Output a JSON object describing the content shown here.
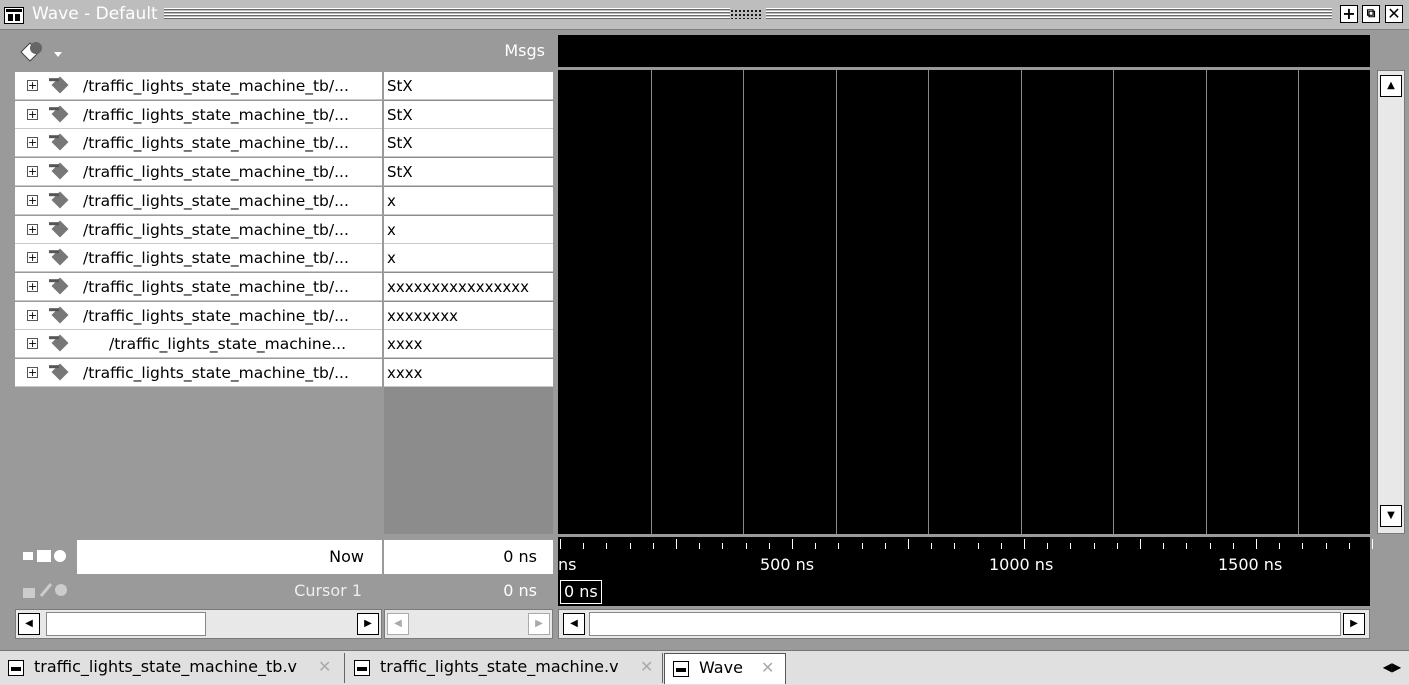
{
  "window": {
    "title": "Wave - Default"
  },
  "columns": {
    "msgs": "Msgs"
  },
  "signals": [
    {
      "name": "/traffic_lights_state_machine_tb/...",
      "value": "StX"
    },
    {
      "name": "/traffic_lights_state_machine_tb/...",
      "value": "StX"
    },
    {
      "name": "/traffic_lights_state_machine_tb/...",
      "value": "StX"
    },
    {
      "name": "/traffic_lights_state_machine_tb/...",
      "value": "StX"
    },
    {
      "name": "/traffic_lights_state_machine_tb/...",
      "value": "x"
    },
    {
      "name": "/traffic_lights_state_machine_tb/...",
      "value": "x"
    },
    {
      "name": "/traffic_lights_state_machine_tb/...",
      "value": "x"
    },
    {
      "name": "/traffic_lights_state_machine_tb/...",
      "value": "xxxxxxxxxxxxxxxx"
    },
    {
      "name": "/traffic_lights_state_machine_tb/...",
      "value": "xxxxxxxx"
    },
    {
      "name": "/traffic_lights_state_machine...",
      "value": "xxxx"
    },
    {
      "name": "/traffic_lights_state_machine_tb/...",
      "value": "xxxx"
    }
  ],
  "now": {
    "label": "Now",
    "value": "0 ns"
  },
  "cursor": {
    "label": "Cursor 1",
    "value": "0 ns",
    "marker": "0 ns"
  },
  "timeline": {
    "start_label": "ns",
    "labels": [
      "500 ns",
      "1000 ns",
      "1500 ns"
    ]
  },
  "tabs": [
    {
      "label": "traffic_lights_state_machine_tb.v"
    },
    {
      "label": "traffic_lights_state_machine.v"
    },
    {
      "label": "Wave"
    }
  ],
  "icons": {
    "window": "wave-window-icon",
    "dock": "dock-icon",
    "undock": "undock-icon",
    "close": "close-icon"
  }
}
